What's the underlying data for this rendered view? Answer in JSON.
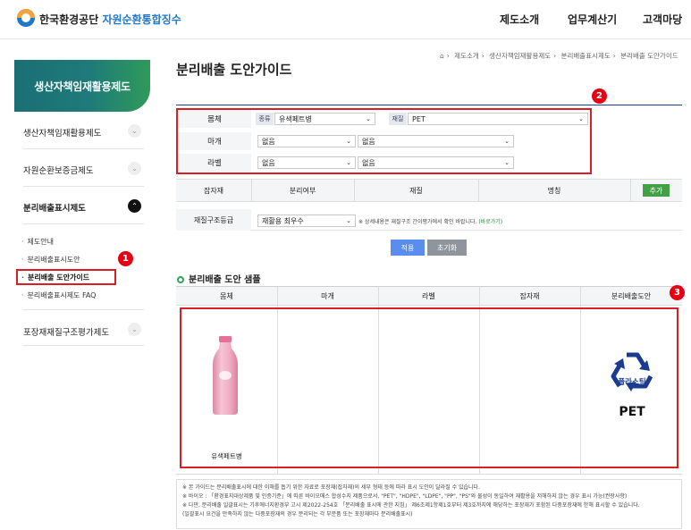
{
  "header": {
    "brand_main": "한국환경공단",
    "brand_sub": "자원순환통합징수",
    "nav": [
      "제도소개",
      "업무계산기",
      "고객마당"
    ]
  },
  "sidebar": {
    "title": "생산자책임재활용제도",
    "items": [
      {
        "label": "생산자책임재활용제도"
      },
      {
        "label": "자원순환보증금제도"
      },
      {
        "label": "분리배출표시제도"
      },
      {
        "label": "포장재재질구조평가제도"
      }
    ],
    "subitems": [
      "제도안내",
      "분리배출표시도안",
      "분리배출 도안가이드",
      "분리배출표시제도 FAQ"
    ]
  },
  "page": {
    "title": "분리배출 도안가이드",
    "breadcrumb": [
      "제도소개",
      "생산자책임재활용제도",
      "분리배출표시제도",
      "분리배출 도안가이드"
    ]
  },
  "form": {
    "row1": {
      "label": "몸체",
      "tag1": "종류",
      "select1": "유색페트병",
      "tag2": "재질",
      "select2": "PET"
    },
    "row2": {
      "label": "마개",
      "select1": "없음",
      "select2": "없음"
    },
    "row3": {
      "label": "라벨",
      "select1": "없음",
      "select2": "없음"
    },
    "attach_header": [
      "잡자재",
      "분리여부",
      "재질",
      "명칭"
    ],
    "add_button": "추가",
    "grade_label": "재질구조등급",
    "grade_select": "재활용 최우수",
    "grade_note": "※ 상세내용은 재질구조 간이평가에서 확인 바랍니다.",
    "grade_link": "(바로가기)",
    "apply_button": "적용",
    "reset_button": "초기화"
  },
  "sample": {
    "title": "분리배출 도안 샘플",
    "columns": [
      "몸체",
      "마개",
      "라벨",
      "잡자재",
      "분리배출도안"
    ],
    "body_caption": "유색페트병",
    "mark_text": "플라스틱",
    "mark_material": "PET"
  },
  "notes": [
    "※ 본 가이드는 분리배출표시에 대한 이해를 돕기 위한 자료로 포장재(잡자재)의 세부 형태 등에 따라 표시 도안이 달라질 수 있습니다.",
    "※ 바이오 : 「환경표지대상제품 및 인증기준」에 따른 바이오매스 합성수지 제품으로서, \"PET\", \"HDPE\", \"LDPE\", \"PP\", \"PS\"와 물성이 동일하여 재활용을 저해하지 않는 경우 표시 가능(권장사항)",
    "※ 다만, 분리배출 일괄표시는 기후에너지환경부 고시 제2022-254호 「분리배출 표시에 관한 지침」 제6조제1항제1호부터 제3호까지에 해당하는 포장재가 포함된 다중포장재에 한해 표시할 수 있습니다.",
    "(일괄표시 요건을 만족하지 않는 다중포장재의 경우 분리되는 각 부분품 또는 포장재마다 분리배출표시)"
  ],
  "badges": [
    "1",
    "2",
    "3"
  ],
  "colors": {
    "accent": "#1f78c8",
    "highlight": "#d81f26",
    "green_button": "#43a047",
    "apply": "#5b8def",
    "reset": "#8f959c",
    "bottle": "#f3b3c8",
    "mark": "#1a3b8f"
  }
}
